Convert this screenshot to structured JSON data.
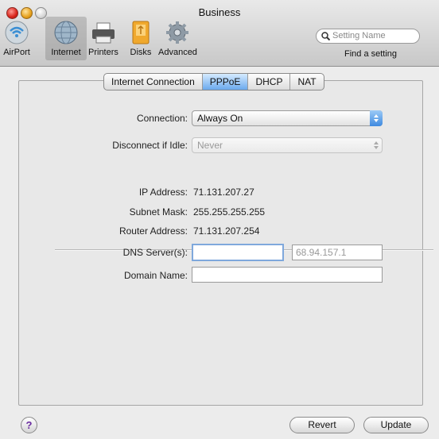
{
  "window": {
    "title": "Business"
  },
  "toolbar": {
    "items": [
      {
        "label": "AirPort",
        "icon": "airport-icon"
      },
      {
        "label": "Internet",
        "icon": "globe-icon"
      },
      {
        "label": "Printers",
        "icon": "printer-icon"
      },
      {
        "label": "Disks",
        "icon": "disk-icon"
      },
      {
        "label": "Advanced",
        "icon": "gear-icon"
      }
    ],
    "selected": "Internet",
    "search_placeholder": "Setting Name",
    "find_label": "Find a setting"
  },
  "tabs": [
    "Internet Connection",
    "PPPoE",
    "DHCP",
    "NAT"
  ],
  "active_tab": "PPPoE",
  "form": {
    "connection_label": "Connection:",
    "connection_value": "Always On",
    "disconnect_label": "Disconnect if Idle:",
    "disconnect_value": "Never",
    "ip_label": "IP Address:",
    "ip_value": "71.131.207.27",
    "subnet_label": "Subnet Mask:",
    "subnet_value": "255.255.255.255",
    "router_label": "Router Address:",
    "router_value": "71.131.207.254",
    "dns_label": "DNS Server(s):",
    "dns_primary": "",
    "dns_secondary_placeholder": "68.94.157.1",
    "domain_label": "Domain Name:",
    "domain_value": ""
  },
  "footer": {
    "help": "?",
    "revert": "Revert",
    "update": "Update"
  },
  "colors": {
    "accent": "#3f8ae0",
    "tab_active": "#6aa9ed",
    "panel": "#e8e8e8"
  }
}
